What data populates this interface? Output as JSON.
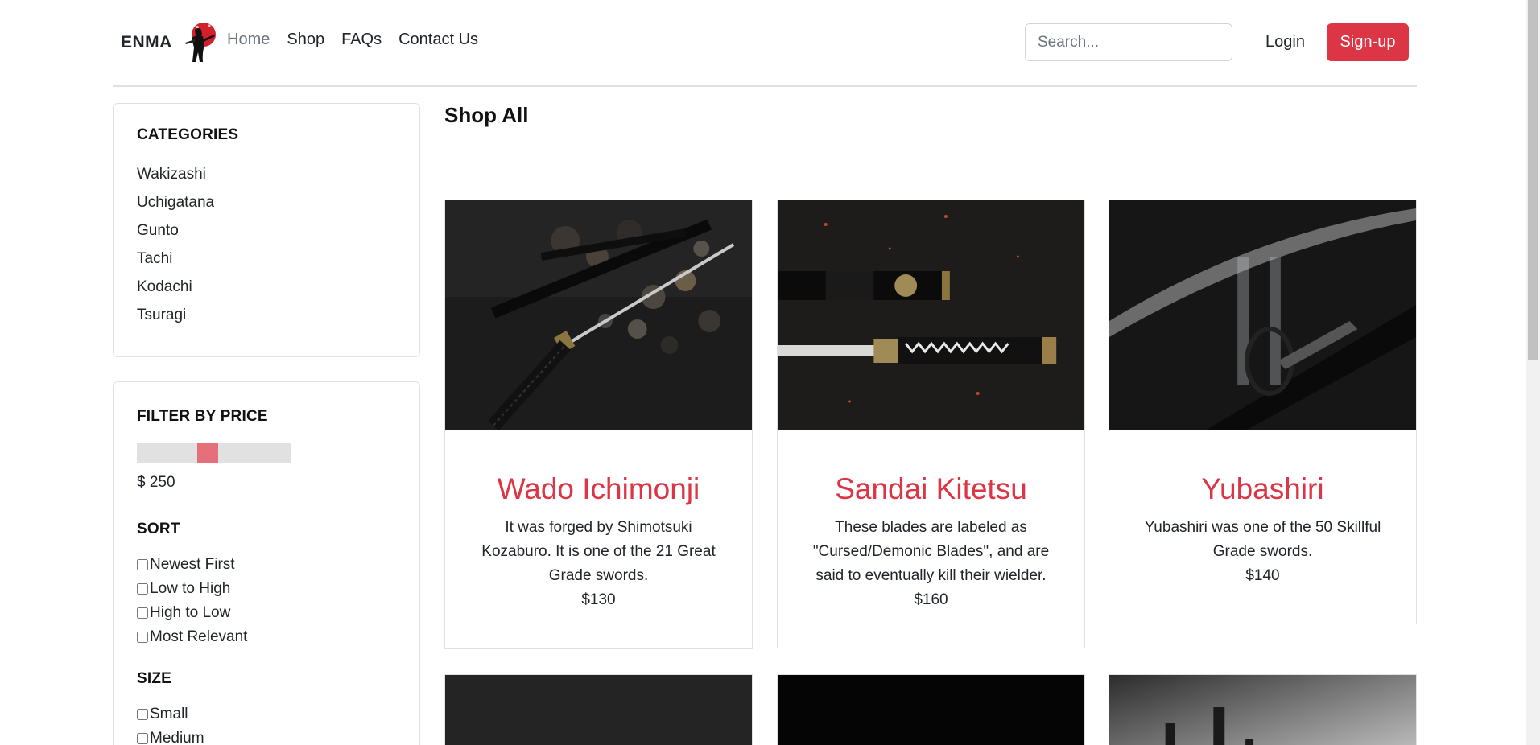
{
  "header": {
    "brand": "ENMA",
    "nav": [
      "Home",
      "Shop",
      "FAQs",
      "Contact Us"
    ],
    "search_placeholder": "Search...",
    "login_label": "Login",
    "signup_label": "Sign-up"
  },
  "sidebar": {
    "categories_title": "CATEGORIES",
    "categories": [
      "Wakizashi",
      "Uchigatana",
      "Gunto",
      "Tachi",
      "Kodachi",
      "Tsuragi"
    ],
    "filter_title": "FILTER BY PRICE",
    "price_value": "$ 250",
    "price_slider_fraction": 0.45,
    "sort_title": "SORT",
    "sort_options": [
      "Newest First",
      "Low to High",
      "High to Low",
      "Most Relevant"
    ],
    "size_title": "SIZE",
    "size_options": [
      "Small",
      "Medium"
    ]
  },
  "main": {
    "title": "Shop All",
    "products": [
      {
        "name": "Wado Ichimonji",
        "description": "It was forged by Shimotsuki Kozaburo. It is one of the 21 Great Grade swords.",
        "price": "$130"
      },
      {
        "name": "Sandai Kitetsu",
        "description": "These blades are labeled as \"Cursed/Demonic Blades\", and are said to eventually kill their wielder.",
        "price": "$160"
      },
      {
        "name": "Yubashiri",
        "description": "Yubashiri was one of the 50 Skillful Grade swords.",
        "price": "$140"
      }
    ]
  },
  "colors": {
    "accent": "#dc3545",
    "slider_thumb": "#e5707b",
    "border": "#dee2e6"
  }
}
